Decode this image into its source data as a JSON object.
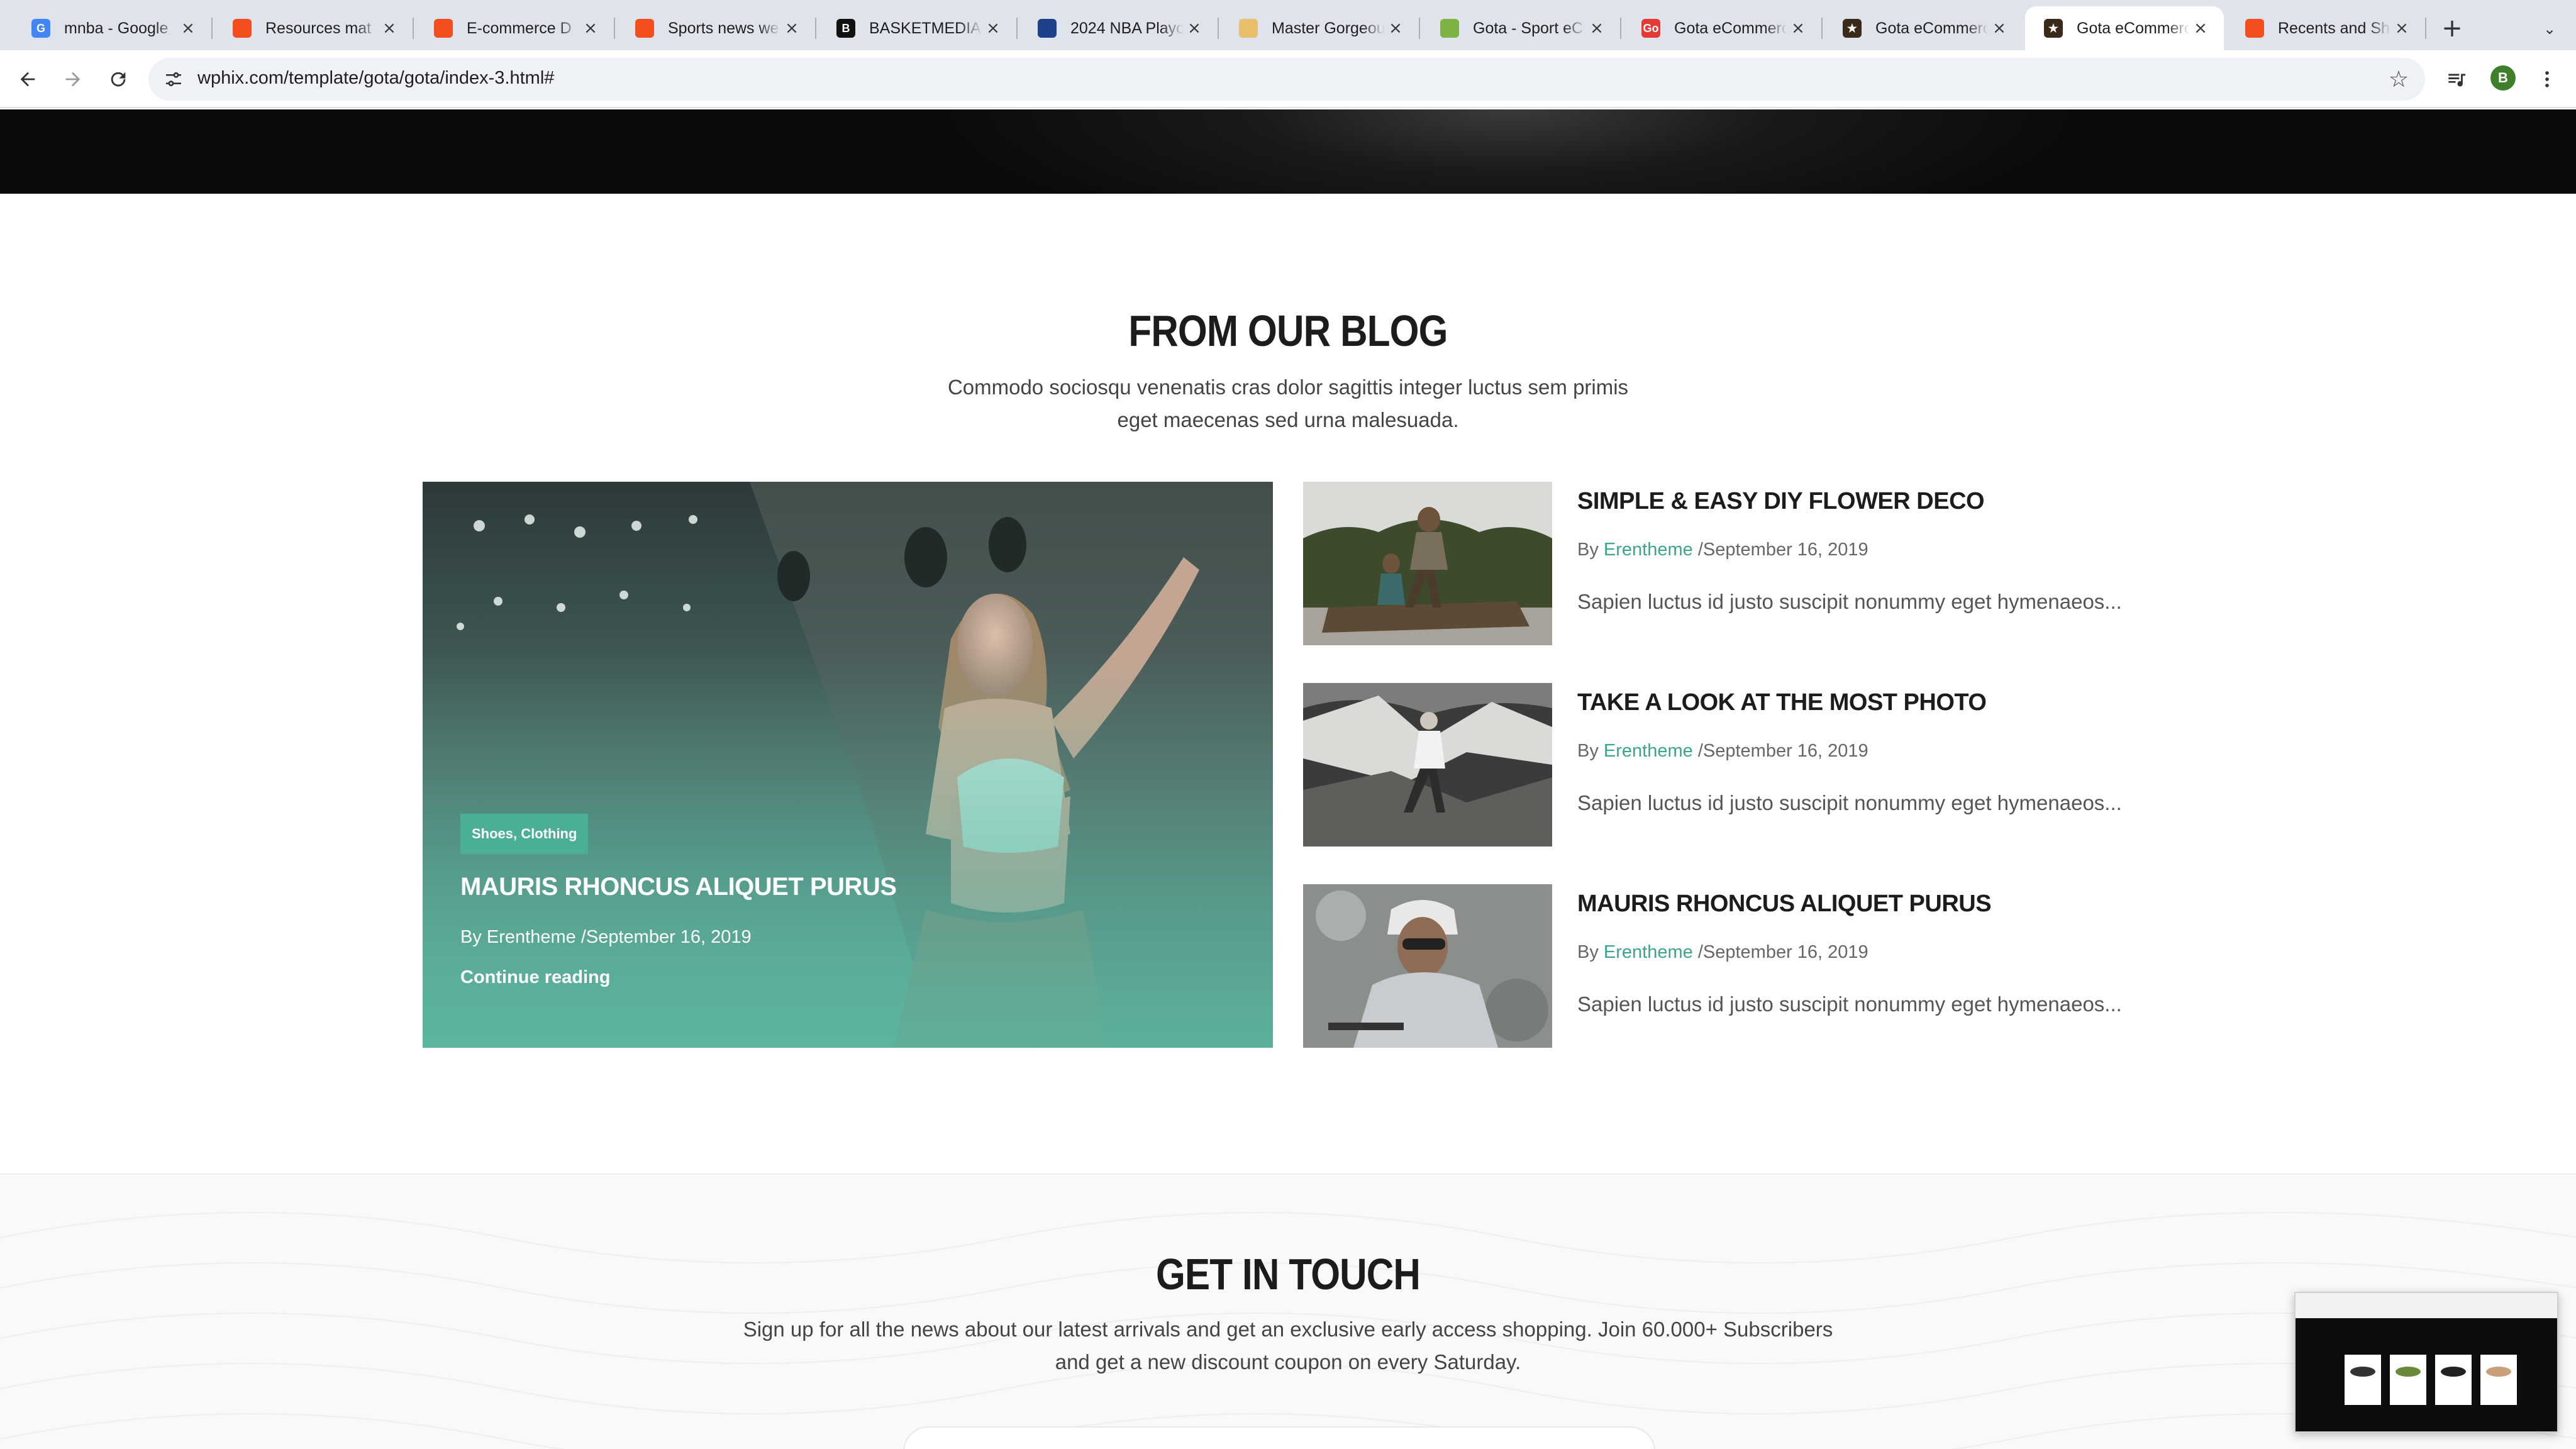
{
  "browser": {
    "tabs": [
      {
        "title": "mnba - Google",
        "favicon": "google-icon",
        "color": "#4285f4",
        "glyph": "G"
      },
      {
        "title": "Resources mat",
        "favicon": "figma-icon",
        "color": "#f24e1e",
        "glyph": ""
      },
      {
        "title": "E-commerce D",
        "favicon": "figma-icon",
        "color": "#f24e1e",
        "glyph": ""
      },
      {
        "title": "Sports news we",
        "favicon": "figma-icon",
        "color": "#f24e1e",
        "glyph": ""
      },
      {
        "title": "BASKETMEDIA",
        "favicon": "basketmedia-icon",
        "color": "#111111",
        "glyph": "B"
      },
      {
        "title": "2024 NBA Playo",
        "favicon": "nba-icon",
        "color": "#1d428a",
        "glyph": ""
      },
      {
        "title": "Master Gorgeou",
        "favicon": "ice-cream-icon",
        "color": "#e8c06b",
        "glyph": ""
      },
      {
        "title": "Gota - Sport eC",
        "favicon": "leaf-icon",
        "color": "#7cb342",
        "glyph": ""
      },
      {
        "title": "Gota eCommerc",
        "favicon": "go-icon",
        "color": "#e53935",
        "glyph": "Go"
      },
      {
        "title": "Gota eCommerc",
        "favicon": "star-logo-icon",
        "color": "#3a2a1a",
        "glyph": "★"
      },
      {
        "title": "Gota eCommerc",
        "favicon": "star-logo-icon",
        "color": "#3a2a1a",
        "glyph": "★",
        "active": true
      },
      {
        "title": "Recents and Sh",
        "favicon": "figma-icon",
        "color": "#f24e1e",
        "glyph": ""
      }
    ],
    "url": "wphix.com/template/gota/gota/index-3.html#",
    "avatar_letter": "B"
  },
  "blog": {
    "title": "FROM OUR BLOG",
    "subtitle_line1": "Commodo sociosqu venenatis cras dolor sagittis integer luctus sem primis",
    "subtitle_line2": "eget maecenas sed urna malesuada.",
    "featured": {
      "tag": "Shoes, Clothing",
      "title": "MAURIS RHONCUS ALIQUET PURUS",
      "meta": "By Erentheme /September 16, 2019",
      "more": "Continue reading"
    },
    "posts": [
      {
        "title": "SIMPLE & EASY DIY FLOWER DECO",
        "by": "By ",
        "author": "Erentheme",
        "date": " /September 16, 2019",
        "excerpt": "Sapien luctus id justo suscipit nonummy eget hymenaeos..."
      },
      {
        "title": "TAKE A LOOK AT THE MOST PHOTO",
        "by": "By ",
        "author": "Erentheme",
        "date": " /September 16, 2019",
        "excerpt": "Sapien luctus id justo suscipit nonummy eget hymenaeos..."
      },
      {
        "title": "MAURIS RHONCUS ALIQUET PURUS",
        "by": "By ",
        "author": "Erentheme",
        "date": " /September 16, 2019",
        "excerpt": "Sapien luctus id justo suscipit nonummy eget hymenaeos..."
      }
    ],
    "accent": "#3aa78c"
  },
  "touch": {
    "title": "GET IN TOUCH",
    "line1": "Sign up for all the news about our latest arrivals and get an exclusive early access shopping. Join 60.000+ Subscribers",
    "line2": "and get a new discount coupon on every Saturday."
  }
}
